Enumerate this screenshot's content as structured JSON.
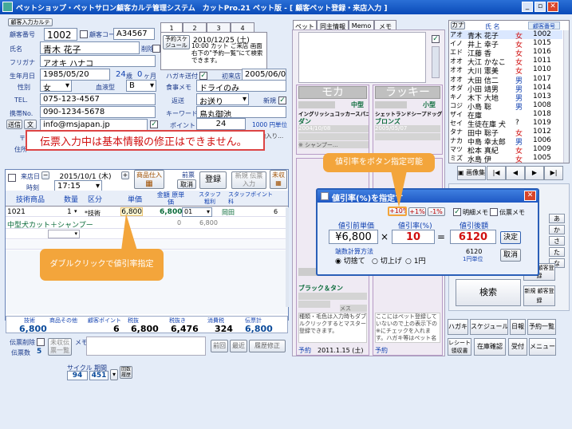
{
  "window": {
    "title": "ペットショップ・ペットサロン顧客カルテ管理システム　カットPro.21 ペット版 - [ 顧客ペット登録・来店入力 ]",
    "min": "_",
    "max": "▫",
    "close": "✕"
  },
  "customer": {
    "search_btn": "顧客入力カルテ",
    "id_label": "顧客番号",
    "id": "1002",
    "code_label": "顧客コード",
    "code": "A34567",
    "delete_label": "削除",
    "name_label": "氏名",
    "name": "青木 花子",
    "kana_label": "フリガナ",
    "kana": "アオキ ハナコ",
    "birth_label": "生年月日",
    "birth": "1985/05/20",
    "age": "24",
    "age_unit": "歳",
    "months": "0",
    "months_unit": "ヶ月",
    "gender_label": "性別",
    "gender": "女",
    "blood_label": "血液型",
    "blood": "B",
    "tel_label": "TEL.",
    "tel": "075-123-4567",
    "mobile_label": "携帯No.",
    "mobile": "090-1234-5678",
    "mail_btn1": "送信",
    "mail_btn2": "文",
    "email": "info@msjapan.jp",
    "postal_label": "〒",
    "address_label": "住所"
  },
  "schedule": {
    "tabs": [
      "1",
      "2",
      "3",
      "4"
    ],
    "yoyaku_btn": "予約スケジュール",
    "date": "2010/12/25 (土)",
    "note": "10:00 カット ご来店 画面右下の\"予約一覧\"にて検索できます。"
  },
  "profile": {
    "dm_label": "ハガキ送付",
    "first_visit_label": "初来店",
    "first_visit": "2005/06/05",
    "food_label": "食事メモ",
    "food": "ドライのみ",
    "pickup_label": "返送",
    "pickup": "お送り",
    "new_label": "新規",
    "keyword_label": "キーワード",
    "keyword": "鳥丸御池",
    "point_label": "ポイント",
    "points": "24",
    "point_rate": "1000 円単位",
    "info": "鴨居鳥丸より2本目の路地入り..."
  },
  "warning": "伝票入力中は基本情報の修正はできません。",
  "slip": {
    "visit_label": "来店日",
    "visit_date": "2015/10/1 (木)",
    "time_label": "時刻",
    "time": "17:15",
    "goods_btn": "商品仕入",
    "cancel_label": "前票",
    "cancel_btn": "取消",
    "register_btn": "登録",
    "new_slip_btn": "新規 伝票入力",
    "unsettled_btn": "未収",
    "headers": [
      "技術商品",
      "数量",
      "区分",
      "単価",
      "金額 原単価",
      "スタッフ 粗利",
      "スタッフポイント 科"
    ],
    "rows": [
      {
        "code": "1021",
        "qty": "1",
        "kind": "*技術",
        "price": "6,800",
        "amount": "6,800",
        "staff": "01",
        "staff_name": "岡田",
        "point": "6"
      },
      {
        "code": "中型犬カット＋シャンプー",
        "qty": "",
        "kind": "",
        "price": "",
        "amount": "0",
        "staff": "6,800",
        "staff_name": "",
        "point": ""
      }
    ],
    "totals_headers": [
      "技術",
      "商品その他",
      "顧客ポイント",
      "税抜",
      "税抜き",
      "消費税",
      "伝票計"
    ],
    "totals": [
      "6,800",
      "",
      "6",
      "6,800",
      "6,476",
      "324",
      "6,800"
    ],
    "delete_label": "伝票削除",
    "count_label": "伝票数",
    "count": "5",
    "unpaid_btn": "未収伝票一覧",
    "memo_label": "メモ",
    "prev_btn": "前回",
    "recent_btn": "最近",
    "history_btn": "履歴修正",
    "size_label": "サイクル",
    "interval_label": "期間",
    "size": "94",
    "interval": "451",
    "count_btn": "回数 履歴"
  },
  "pets": {
    "tabs": [
      "ペット",
      "同主情報",
      "Memo",
      "メモ"
    ],
    "pet1": {
      "name": "モカ",
      "size": "中型",
      "breed": "イングリッシュコッカースパニエル",
      "color": "ダン",
      "birth": "2004/10/08",
      "age": "7歳",
      "memo": "※ シャンプー..."
    },
    "pet2": {
      "name": "ラッキー",
      "size": "小型",
      "breed": "シェットランドシープドッグ",
      "color": "ブロンズ",
      "birth": "2005/05/07",
      "age": "6歳"
    },
    "pet3": {
      "color": "ブラック＆タン",
      "gender": "メス",
      "reserve": "予約",
      "reserve_date": "2011.1.15 (土)",
      "memo": "種類・毛色は入力時もダブルクリックするとマスター登録できます。"
    },
    "pet4": {
      "memo": "ここにはペット登録していないので上の表示下の※にチェックを入れます。ハガキ等はペット名表示します。",
      "reserve": "予約"
    }
  },
  "customers_list": {
    "tab": "カナ",
    "col_name": "氏 名",
    "col_no": "顧客番号",
    "rows": [
      [
        "アオ",
        "青木 花子",
        "女",
        "1002"
      ],
      [
        "イノ",
        "井上 幸子",
        "女",
        "1015"
      ],
      [
        "エド",
        "江藤 香",
        "女",
        "1016"
      ],
      [
        "オオ",
        "大江 かなこ",
        "女",
        "1011"
      ],
      [
        "オオ",
        "大川 憲美",
        "女",
        "1010"
      ],
      [
        "オオ",
        "大田 信二",
        "男",
        "1017"
      ],
      [
        "オダ",
        "小田 靖男",
        "男",
        "1014"
      ],
      [
        "キノ",
        "木下 大地",
        "男",
        "1013"
      ],
      [
        "コジ",
        "小島 聡",
        "男",
        "1008"
      ],
      [
        "ザイ",
        "在庫",
        "",
        "1018"
      ],
      [
        "セイ",
        "生徒在庫 犬",
        "?",
        "1019"
      ],
      [
        "タナ",
        "田中 聡子",
        "女",
        "1012"
      ],
      [
        "ナカ",
        "中島 幸太郎",
        "男",
        "1006"
      ],
      [
        "マツ",
        "松本 真紀",
        "女",
        "1009"
      ],
      [
        "ミズ",
        "水島 伊",
        "女",
        "1005"
      ]
    ],
    "image_btn": "画像集",
    "nav": [
      "|◀",
      "◀",
      "▶",
      "▶|"
    ],
    "kana_keys": [
      "あ",
      "か",
      "さ",
      "た",
      "な",
      "は",
      "ま",
      "や",
      "ら",
      "わ"
    ],
    "search_btn": "検索",
    "new_btn": "新規 顧客登録",
    "temp_btn": "一時 顧客登録",
    "bottom_btns": [
      "ハガキ",
      "スケジュール",
      "日報",
      "予約一覧",
      "レシート 領収書",
      "在庫確認",
      "受付",
      "メニュー"
    ]
  },
  "dialog": {
    "title": "値引率(%)を指定す",
    "btns": [
      "+10%",
      "+1%",
      "-1%"
    ],
    "memo_chk": "明細メモ",
    "slip_chk": "伝票メモ",
    "before_label": "値引前単価",
    "before": "¥6,800",
    "rate_label": "値引率(%)",
    "rate": "10",
    "after_label": "値引後額",
    "after": "6120",
    "round_label": "端数計算方法",
    "round_opts": [
      "切捨て",
      "切上げ",
      "1円"
    ],
    "unit_val": "6120",
    "unit_label": "1円単位",
    "ok_btn": "決定",
    "cancel_btn": "取消"
  },
  "callouts": {
    "button_hint": "値引率をボタン指定可能",
    "dblclick_hint": "ダブルクリックで値引率指定"
  }
}
